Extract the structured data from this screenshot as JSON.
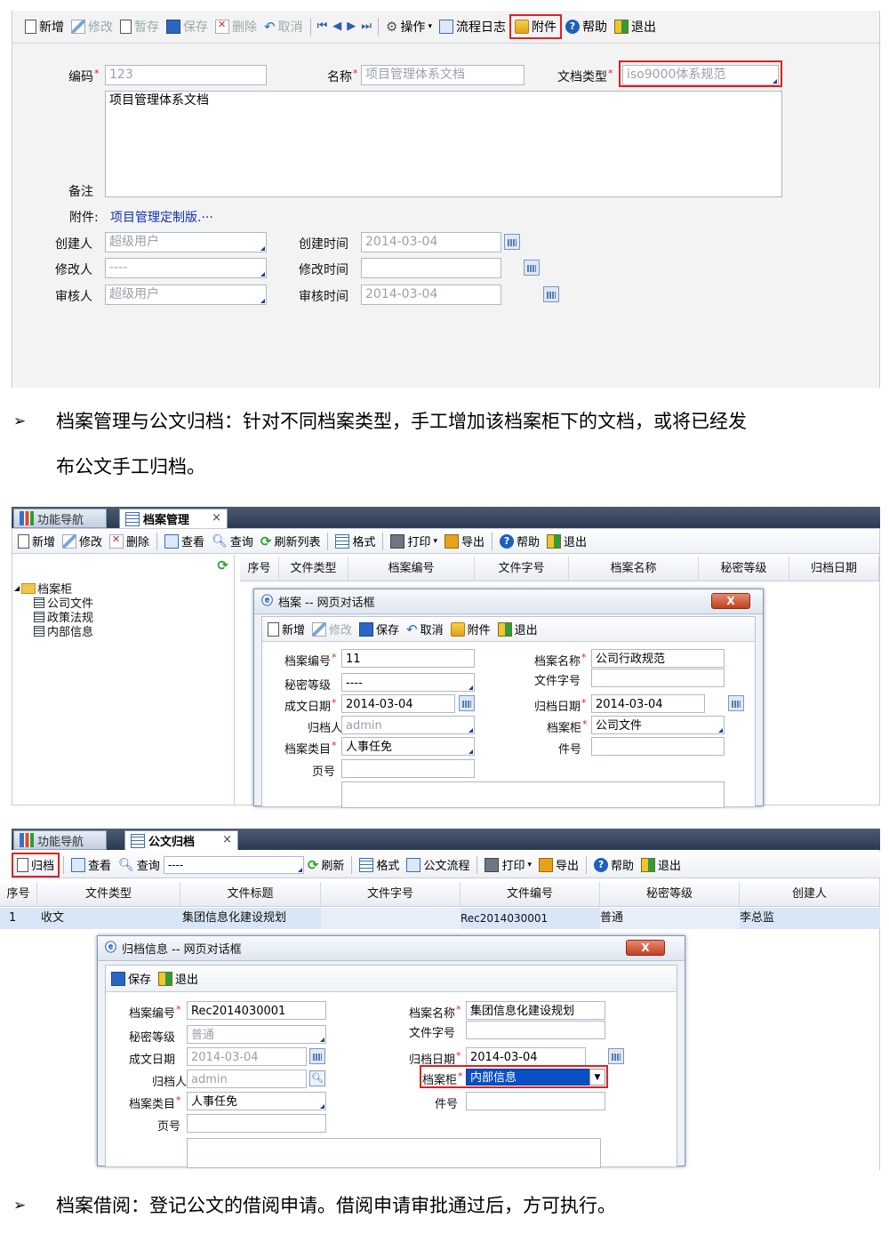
{
  "top_form": {
    "toolbar": {
      "new": "新增",
      "edit": "修改",
      "draft": "暂存",
      "save": "保存",
      "delete": "删除",
      "cancel": "取消",
      "ops": "操作",
      "flow_log": "流程日志",
      "attach": "附件",
      "help": "帮助",
      "exit": "退出"
    },
    "code_label": "编码",
    "code_value": "123",
    "name_label": "名称",
    "name_value": "项目管理体系文档",
    "type_label": "文档类型",
    "type_value": "iso9000体系规范",
    "note_label": "备注",
    "note_value": "项目管理体系文档",
    "attach_label": "附件:",
    "attach_value": "项目管理定制版.···",
    "creator_label": "创建人",
    "creator_value": "超级用户",
    "create_time_label": "创建时间",
    "create_time_value": "2014-03-04",
    "modifier_label": "修改人",
    "modifier_value": "----",
    "modify_time_label": "修改时间",
    "modify_time_value": "",
    "reviewer_label": "审核人",
    "reviewer_value": "超级用户",
    "review_time_label": "审核时间",
    "review_time_value": "2014-03-04"
  },
  "para1": {
    "bullet": "➢",
    "line1": "档案管理与公文归档：针对不同档案类型，手工增加该档案柜下的文档，或将已经发",
    "line2": "布公文手工归档。"
  },
  "archive_screen": {
    "tab_nav": "功能导航",
    "tab_active": "档案管理",
    "tab_close": "×",
    "toolbar": {
      "new": "新增",
      "edit": "修改",
      "delete": "删除",
      "view": "查看",
      "query": "查询",
      "refresh": "刷新列表",
      "format": "格式",
      "print": "打印",
      "export": "导出",
      "help": "帮助",
      "exit": "退出"
    },
    "tree": {
      "root": "档案柜",
      "items": [
        "公司文件",
        "政策法规",
        "内部信息"
      ]
    },
    "columns": [
      "序号",
      "文件类型",
      "档案编号",
      "文件字号",
      "档案名称",
      "秘密等级",
      "归档日期"
    ],
    "dialog": {
      "title": "档案 -- 网页对话框",
      "close": "X",
      "toolbar": {
        "new": "新增",
        "edit": "修改",
        "save": "保存",
        "cancel": "取消",
        "attach": "附件",
        "exit": "退出"
      },
      "no_label": "档案编号",
      "no_value": "11",
      "name_label": "档案名称",
      "name_value": "公司行政规范",
      "secret_label": "秘密等级",
      "secret_value": "----",
      "docno_label": "文件字号",
      "docno_value": "",
      "date_label": "成文日期",
      "date_value": "2014-03-04",
      "archdate_label": "归档日期",
      "archdate_value": "2014-03-04",
      "archiver_label": "归档人",
      "archiver_value": "admin",
      "cabinet_label": "档案柜",
      "cabinet_value": "公司文件",
      "category_label": "档案类目",
      "category_value": "人事任免",
      "pieces_label": "件号",
      "pieces_value": "",
      "pages_label": "页号",
      "pages_value": ""
    }
  },
  "doc_archive_screen": {
    "tab_nav": "功能导航",
    "tab_active": "公文归档",
    "tab_close": "×",
    "toolbar": {
      "archive": "归档",
      "view": "查看",
      "query": "查询",
      "query_value": "----",
      "refresh": "刷新",
      "format": "格式",
      "flow": "公文流程",
      "print": "打印",
      "export": "导出",
      "help": "帮助",
      "exit": "退出"
    },
    "columns": [
      "序号",
      "文件类型",
      "文件标题",
      "文件字号",
      "文件编号",
      "秘密等级",
      "创建人"
    ],
    "rows": [
      {
        "seq": "1",
        "type": "收文",
        "title": "集团信息化建设规划",
        "docno": "",
        "no": "Rec2014030001",
        "secret": "普通",
        "creator": "李总监"
      }
    ],
    "dialog": {
      "title": "归档信息 -- 网页对话框",
      "close": "X",
      "toolbar": {
        "save": "保存",
        "exit": "退出"
      },
      "no_label": "档案编号",
      "no_value": "Rec2014030001",
      "name_label": "档案名称",
      "name_value": "集团信息化建设规划",
      "secret_label": "秘密等级",
      "secret_value": "普通",
      "docno_label": "文件字号",
      "docno_value": "",
      "date_label": "成文日期",
      "date_value": "2014-03-04",
      "archdate_label": "归档日期",
      "archdate_value": "2014-03-04",
      "archiver_label": "归档人",
      "archiver_value": "admin",
      "cabinet_label": "档案柜",
      "cabinet_value": "内部信息",
      "category_label": "档案类目",
      "category_value": "人事任免",
      "pieces_label": "件号",
      "pieces_value": "",
      "pages_label": "页号",
      "pages_value": ""
    }
  },
  "para2": {
    "bullet": "➢",
    "line1": "档案借阅：登记公文的借阅申请。借阅申请审批通过后，方可执行。"
  },
  "colors": {
    "accent_red": "#e02020",
    "selection_blue": "#0a4fc4",
    "tabbar": "#3a4860"
  }
}
